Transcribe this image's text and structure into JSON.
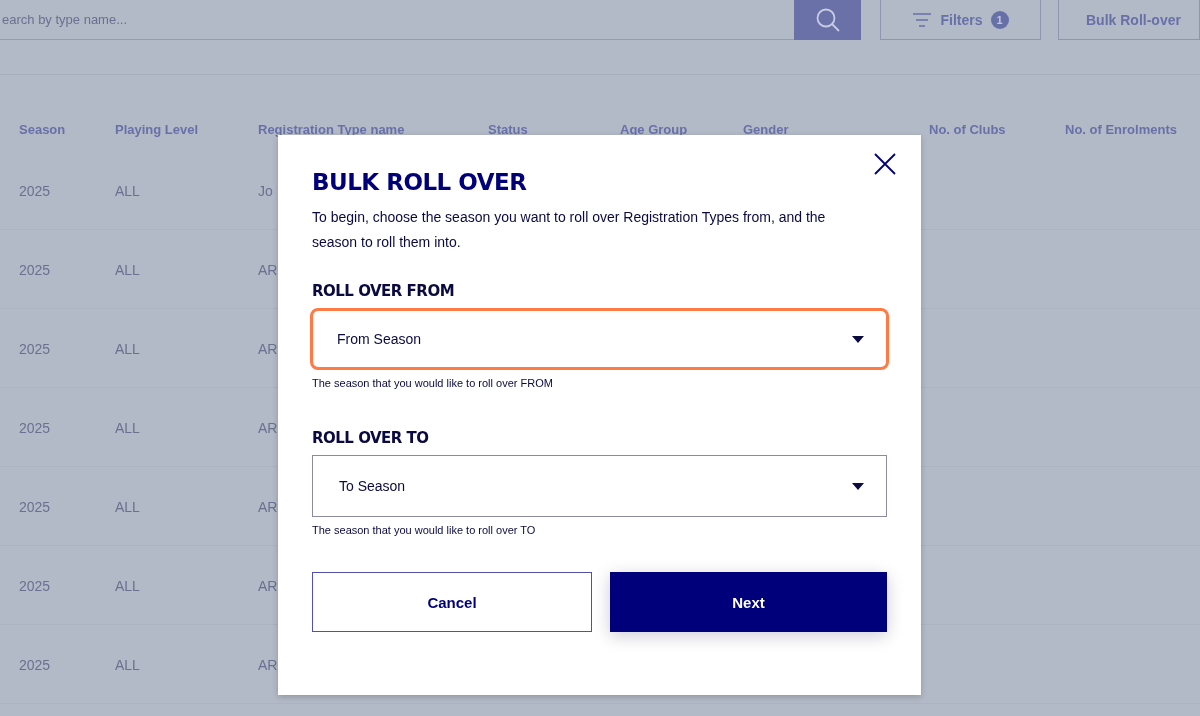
{
  "toolbar": {
    "search_placeholder": "earch by type name...",
    "filters_label": "Filters",
    "filters_count": "1",
    "bulk_button": "Bulk Roll-over"
  },
  "table": {
    "columns": [
      "Season",
      "Playing Level",
      "Registration Type name",
      "Status",
      "Age Group",
      "Gender",
      "No. of Clubs",
      "No. of Enrolments"
    ],
    "rows": [
      [
        "2025",
        "ALL",
        "Jo"
      ],
      [
        "2025",
        "ALL",
        "AR"
      ],
      [
        "2025",
        "ALL",
        "AR"
      ],
      [
        "2025",
        "ALL",
        "AR"
      ],
      [
        "2025",
        "ALL",
        "AR"
      ],
      [
        "2025",
        "ALL",
        "AR"
      ],
      [
        "2025",
        "ALL",
        "AR"
      ]
    ]
  },
  "dialog": {
    "title": "BULK ROLL OVER",
    "intro": "To begin, choose the season you want to roll over Registration Types from, and the season to roll them into.",
    "fields": [
      {
        "label": "ROLL OVER FROM",
        "value": "From Season",
        "hint": "The season that you would like to roll over FROM",
        "highlighted": true
      },
      {
        "label": "ROLL OVER TO",
        "value": "To Season",
        "hint": "The season that you would like to roll over TO",
        "highlighted": false
      }
    ],
    "buttons": [
      {
        "label": "Cancel",
        "kind": "secondary"
      },
      {
        "label": "Next",
        "kind": "primary"
      }
    ]
  }
}
